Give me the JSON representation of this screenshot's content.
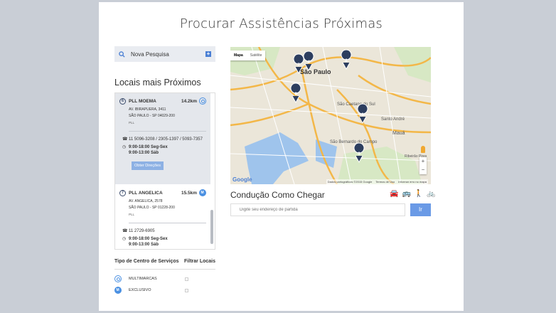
{
  "page": {
    "title": "Procurar Assistências Próximas"
  },
  "search": {
    "label": "Nova Pesquisa",
    "add_icon": "plus-icon"
  },
  "nearby": {
    "heading": "Locais mais Próximos"
  },
  "locations": [
    {
      "number": "6",
      "name": "PLL MOEMA",
      "distance": "14.2km",
      "type_icon": "multimarcas-icon",
      "street": "AV. IBIRAPUERA, 3411",
      "city": "SÃO PAULO - SP 04029-200",
      "brand": "PLL",
      "phones": "11 5096-3208 / 2305-1397 / 5093-7357",
      "hours1": "9:00-18:00 Seg-Sex",
      "hours2": "9:00-13:00 Sáb",
      "directions_label": "Obter Direções"
    },
    {
      "number": "7",
      "name": "PLL ANGELICA",
      "distance": "15.5km",
      "type_icon": "exclusivo-icon",
      "street": "AV. ANGELICA, 2578",
      "city": "SÃO PAULO - SP 01228-200",
      "brand": "PLL",
      "phones": "11 2729-6905",
      "hours1": "9:00-18:00 Seg-Sex",
      "hours2": "9:00-13:00 Sáb"
    }
  ],
  "filters": {
    "type_heading": "Tipo de Centro de Serviços",
    "filter_heading": "Filtrar Locais",
    "options": [
      {
        "label": "MULTIMARCAS",
        "icon": "multimarcas-icon",
        "checked": false
      },
      {
        "label": "EXCLUSIVO",
        "icon": "exclusivo-icon",
        "checked": false
      }
    ]
  },
  "map": {
    "tab_map": "Mapa",
    "tab_satellite": "Satélite",
    "city_labels": [
      "São Paulo",
      "São Caetano do Sul",
      "Santo André",
      "Mauá",
      "São Bernardo do Campo",
      "Ribeirão Pires"
    ],
    "markers": [
      "7",
      "4",
      "2",
      "6",
      "1",
      "3"
    ],
    "google": "Google",
    "footer_data": "Dados cartográficos ©2015 Google",
    "footer_terms": "Termos de Uso",
    "footer_report": "Informar erro no mapa",
    "zoom_in": "+",
    "zoom_out": "−"
  },
  "directions": {
    "heading": "Condução Como Chegar",
    "modes": [
      "car-icon",
      "bus-icon",
      "walk-icon",
      "bike-icon"
    ],
    "placeholder": "Digite seu endereço de partida",
    "go_label": "Ir"
  },
  "colors": {
    "accent": "#4a7fd4",
    "marker": "#2d3e5f",
    "road": "#f3b748"
  }
}
